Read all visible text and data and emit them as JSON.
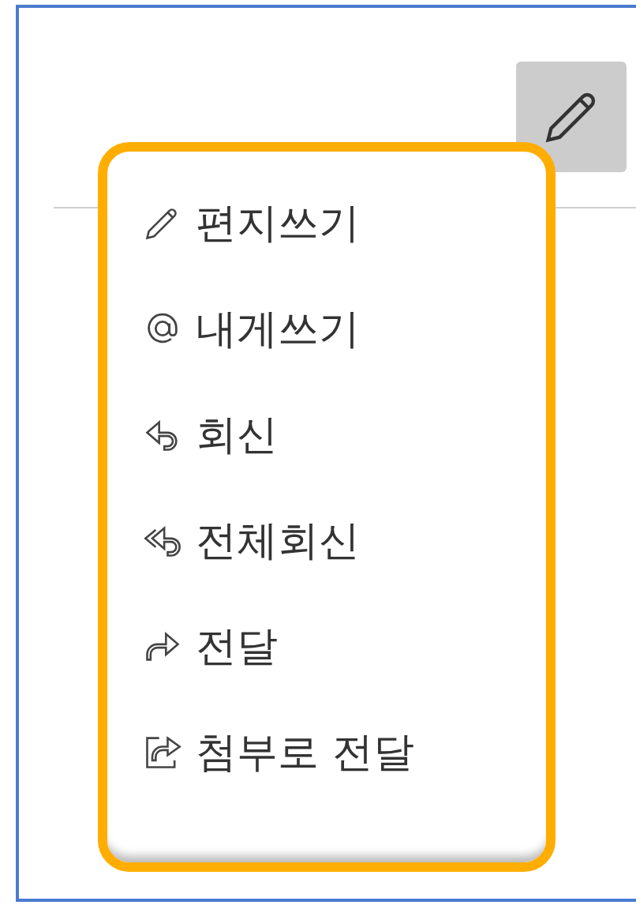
{
  "menu": {
    "items": [
      {
        "kind": "compose",
        "label": "편지쓰기"
      },
      {
        "kind": "note-to-self",
        "label": "내게쓰기"
      },
      {
        "kind": "reply",
        "label": "회신"
      },
      {
        "kind": "reply-all",
        "label": "전체회신"
      },
      {
        "kind": "forward",
        "label": "전달"
      },
      {
        "kind": "forward-attachment",
        "label": "첨부로 전달"
      }
    ]
  }
}
